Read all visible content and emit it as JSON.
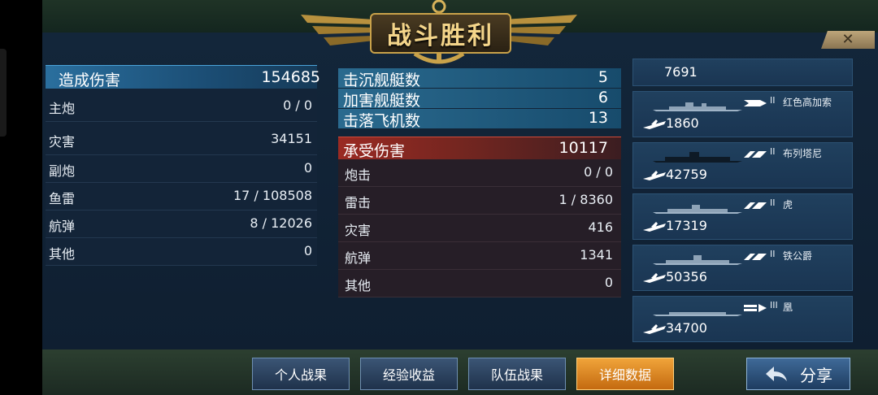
{
  "header": {
    "title": "战斗胜利",
    "close_glyph": "✕"
  },
  "damage_dealt": {
    "label": "造成伤害",
    "total": "154685",
    "rows": [
      {
        "label": "主炮",
        "value": "0 / 0"
      },
      {
        "label": "灾害",
        "value": "34151"
      },
      {
        "label": "副炮",
        "value": "0"
      },
      {
        "label": "鱼雷",
        "value": "17 / 108508"
      },
      {
        "label": "航弹",
        "value": "8 / 12026"
      },
      {
        "label": "其他",
        "value": "0"
      }
    ]
  },
  "kills": [
    {
      "label": "击沉舰艇数",
      "value": "5"
    },
    {
      "label": "加害舰艇数",
      "value": "6"
    },
    {
      "label": "击落飞机数",
      "value": "13"
    }
  ],
  "damage_taken": {
    "label": "承受伤害",
    "total": "10117",
    "rows": [
      {
        "label": "炮击",
        "value": "0 / 0"
      },
      {
        "label": "雷击",
        "value": "1 / 8360"
      },
      {
        "label": "灾害",
        "value": "416"
      },
      {
        "label": "航弹",
        "value": "1341"
      },
      {
        "label": "其他",
        "value": "0"
      }
    ]
  },
  "ships": [
    {
      "damage": "7691",
      "tier": "",
      "name": "",
      "icon": "ship-silhouette"
    },
    {
      "damage": "1860",
      "tier": "II",
      "name": "红色高加索",
      "icon": "cruiser-class-icon"
    },
    {
      "damage": "42759",
      "tier": "II",
      "name": "布列塔尼",
      "icon": "battleship-class-icon"
    },
    {
      "damage": "17319",
      "tier": "II",
      "name": "虎",
      "icon": "battleship-class-icon"
    },
    {
      "damage": "50356",
      "tier": "II",
      "name": "铁公爵",
      "icon": "battleship-class-icon"
    },
    {
      "damage": "34700",
      "tier": "III",
      "name": "凰",
      "icon": "destroyer-class-icon"
    }
  ],
  "tabs": [
    {
      "label": "个人战果",
      "active": false
    },
    {
      "label": "经验收益",
      "active": false
    },
    {
      "label": "队伍战果",
      "active": false
    },
    {
      "label": "详细数据",
      "active": true
    }
  ],
  "share_label": "分享",
  "colors": {
    "accent_blue": "#2a6f9e",
    "accent_red": "#9a2a22",
    "tab_active": "#f0a43a",
    "gold": "#c9a24a"
  }
}
